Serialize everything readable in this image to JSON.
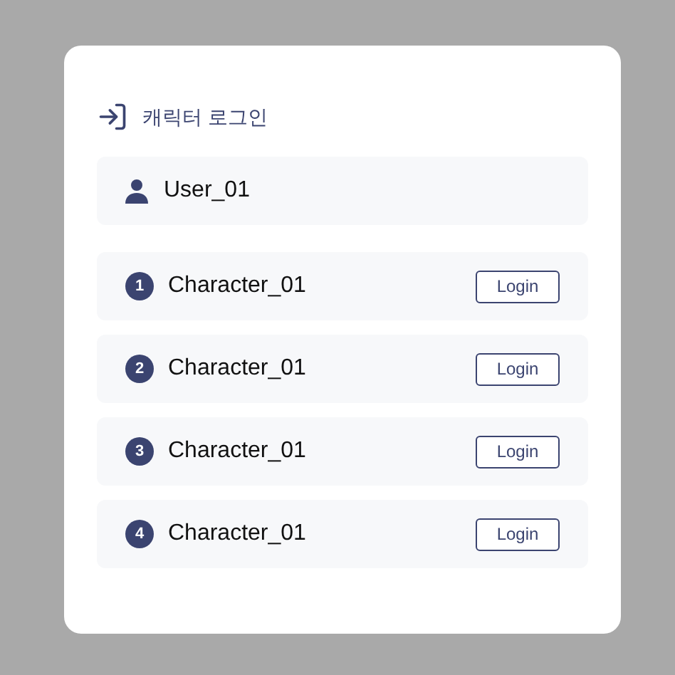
{
  "title": "캐릭터 로그인",
  "user": {
    "name": "User_01"
  },
  "characters": [
    {
      "number": "1",
      "name": "Character_01",
      "button": "Login"
    },
    {
      "number": "2",
      "name": "Character_01",
      "button": "Login"
    },
    {
      "number": "3",
      "name": "Character_01",
      "button": "Login"
    },
    {
      "number": "4",
      "name": "Character_01",
      "button": "Login"
    }
  ]
}
